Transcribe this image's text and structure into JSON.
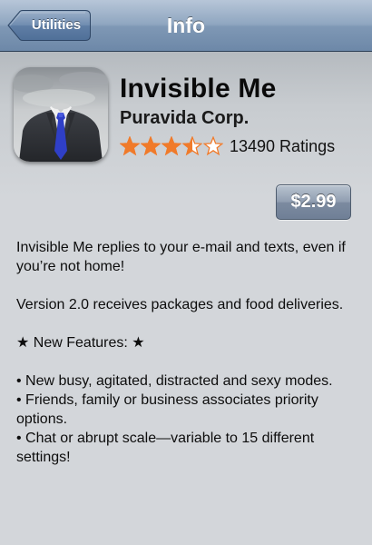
{
  "nav": {
    "back_label": "Utilities",
    "title": "Info"
  },
  "app": {
    "name": "Invisible Me",
    "developer": "Puravida Corp.",
    "rating": 3.5,
    "rating_max": 5,
    "ratings_count": "13490 Ratings",
    "price": "$2.99",
    "icon": "invisible-businessman-icon"
  },
  "description": {
    "paragraph1": "Invisible Me replies to your e-mail and texts, even if you’re not home!",
    "paragraph2": "Version 2.0 receives packages and food deliveries.",
    "features_heading": "★ New Features: ★",
    "features": [
      "• New busy, agitated, distracted and sexy modes.",
      "• Friends, family or business associates priority options.",
      "• Chat or abrupt scale—variable to 15 different settings!"
    ]
  },
  "colors": {
    "nav_bar": "#8fa6c0",
    "star_fill": "#f07a2a",
    "background": "#d3d6da",
    "price_button": "#8f9db0",
    "tie": "#2f3fc7"
  }
}
